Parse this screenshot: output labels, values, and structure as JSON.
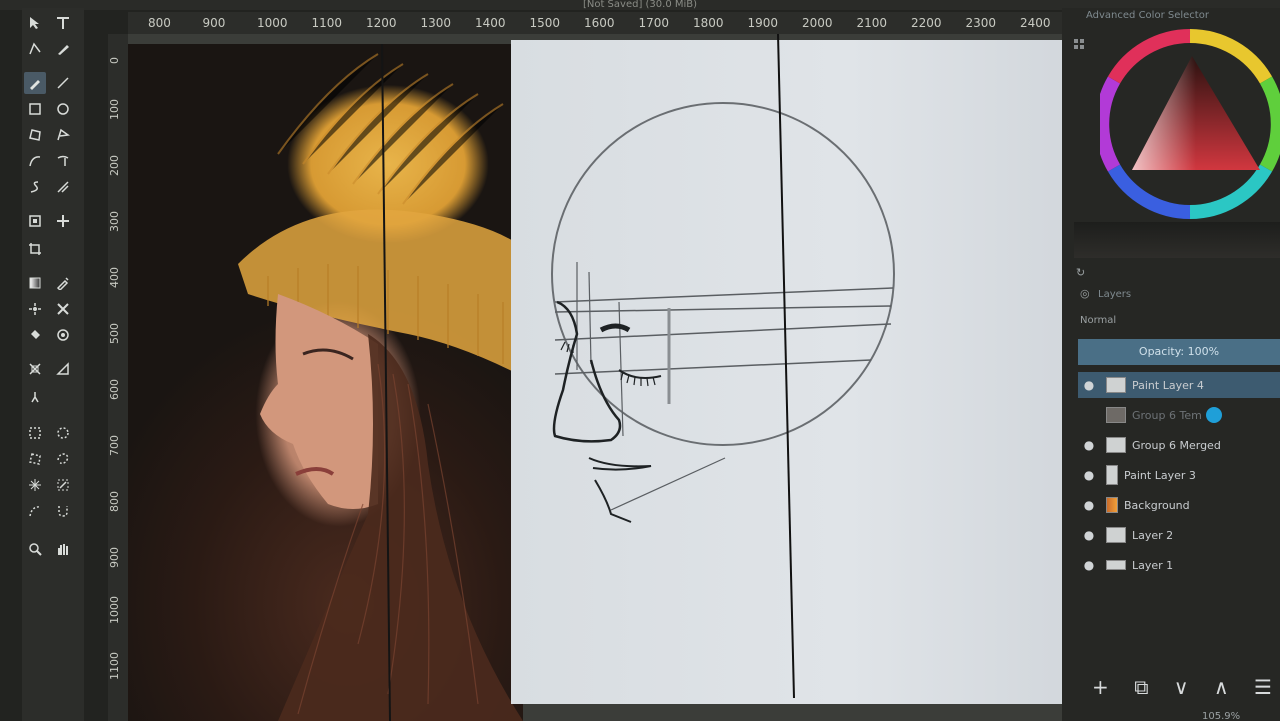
{
  "window": {
    "title": "[Not Saved] (30.0 MiB)"
  },
  "rulers": {
    "horizontal": [
      "800",
      "900",
      "1000",
      "1100",
      "1200",
      "1300",
      "1400",
      "1500",
      "1600",
      "1700",
      "1800",
      "1900",
      "2000",
      "2100",
      "2200",
      "2300",
      "2400"
    ],
    "vertical": [
      "0",
      "100",
      "200",
      "300",
      "400",
      "500",
      "600",
      "700",
      "800",
      "900",
      "1000",
      "1100"
    ]
  },
  "toolbox": {
    "tools": [
      "select-shapes-icon",
      "text-icon",
      "edit-shapes-icon",
      "calligraphy-icon",
      "freehand-brush-icon",
      "line-icon",
      "rectangle-icon",
      "ellipse-icon",
      "polygon-icon",
      "polyline-icon",
      "bezier-icon",
      "freehand-path-icon",
      "dynamic-brush-icon",
      "multibrush-icon",
      "transform-icon",
      "move-icon",
      "crop-icon",
      "gradient-icon",
      "color-picker-icon",
      "colorize-mask-icon",
      "smart-patch-icon",
      "fill-icon",
      "pattern-fill-icon",
      "assistant-icon",
      "measure-icon",
      "reference-images-icon",
      "rect-select-icon",
      "ellipse-select-icon",
      "polygon-select-icon",
      "freehand-select-icon",
      "contiguous-select-icon",
      "similar-select-icon",
      "bezier-select-icon",
      "magnetic-select-icon",
      "zoom-icon",
      "pan-icon"
    ]
  },
  "docker": {
    "color_selector_title": "Advanced Color Selector",
    "layers_title": "Layers",
    "blend_mode": "Normal",
    "opacity_label": "Opacity:",
    "opacity_value": "100%",
    "layers": [
      {
        "name": "Paint Layer 4",
        "visible": true,
        "selected": true
      },
      {
        "name": "Group 6 Tem",
        "visible": false,
        "selected": false
      },
      {
        "name": "Group 6 Merged",
        "visible": true,
        "selected": false
      },
      {
        "name": "Paint Layer 3",
        "visible": true,
        "selected": false
      },
      {
        "name": "Background",
        "visible": true,
        "selected": false
      },
      {
        "name": "Layer 2",
        "visible": true,
        "selected": false
      },
      {
        "name": "Layer 1",
        "visible": true,
        "selected": false
      }
    ],
    "bottom_buttons": {
      "add": "+",
      "duplicate": "⧉",
      "move_down": "∨",
      "move_up": "∧",
      "properties": "☰"
    },
    "zoom": "105.9%"
  },
  "colors": {
    "accent": "#3d5b70",
    "panel": "#262724",
    "sheet": "#dde1e5"
  }
}
